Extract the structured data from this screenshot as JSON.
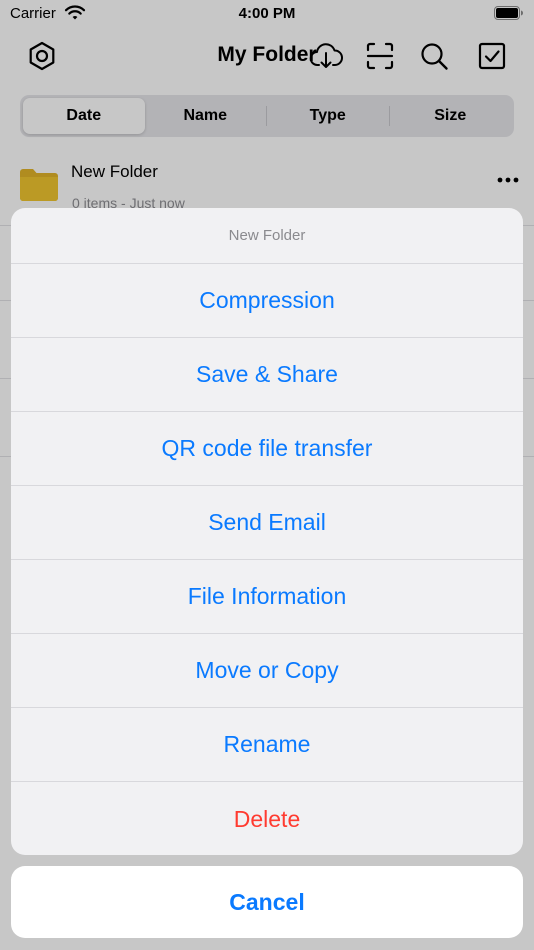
{
  "status_bar": {
    "carrier": "Carrier",
    "time": "4:00 PM"
  },
  "navbar": {
    "title": "My Folder",
    "left_icon": "settings-hexagon-icon",
    "right_icons": [
      "download-cloud-icon",
      "scan-icon",
      "search-icon",
      "select-checkbox-icon"
    ]
  },
  "segmented": {
    "items": [
      {
        "label": "Date",
        "selected": true
      },
      {
        "label": "Name",
        "selected": false
      },
      {
        "label": "Type",
        "selected": false
      },
      {
        "label": "Size",
        "selected": false
      }
    ]
  },
  "file_list": [
    {
      "name": "New Folder",
      "subtitle": "0 items - Just now",
      "icon": "folder-icon"
    }
  ],
  "action_sheet": {
    "title": "New Folder",
    "actions": [
      {
        "label": "Compression",
        "style": "default"
      },
      {
        "label": "Save & Share",
        "style": "default"
      },
      {
        "label": "QR code file transfer",
        "style": "default"
      },
      {
        "label": "Send Email",
        "style": "default"
      },
      {
        "label": "File Information",
        "style": "default"
      },
      {
        "label": "Move or Copy",
        "style": "default"
      },
      {
        "label": "Rename",
        "style": "default"
      },
      {
        "label": "Delete",
        "style": "destructive"
      }
    ],
    "cancel_label": "Cancel"
  },
  "colors": {
    "accent": "#0a7aff",
    "destructive": "#ff3b30",
    "folder": "#e2b42a"
  }
}
